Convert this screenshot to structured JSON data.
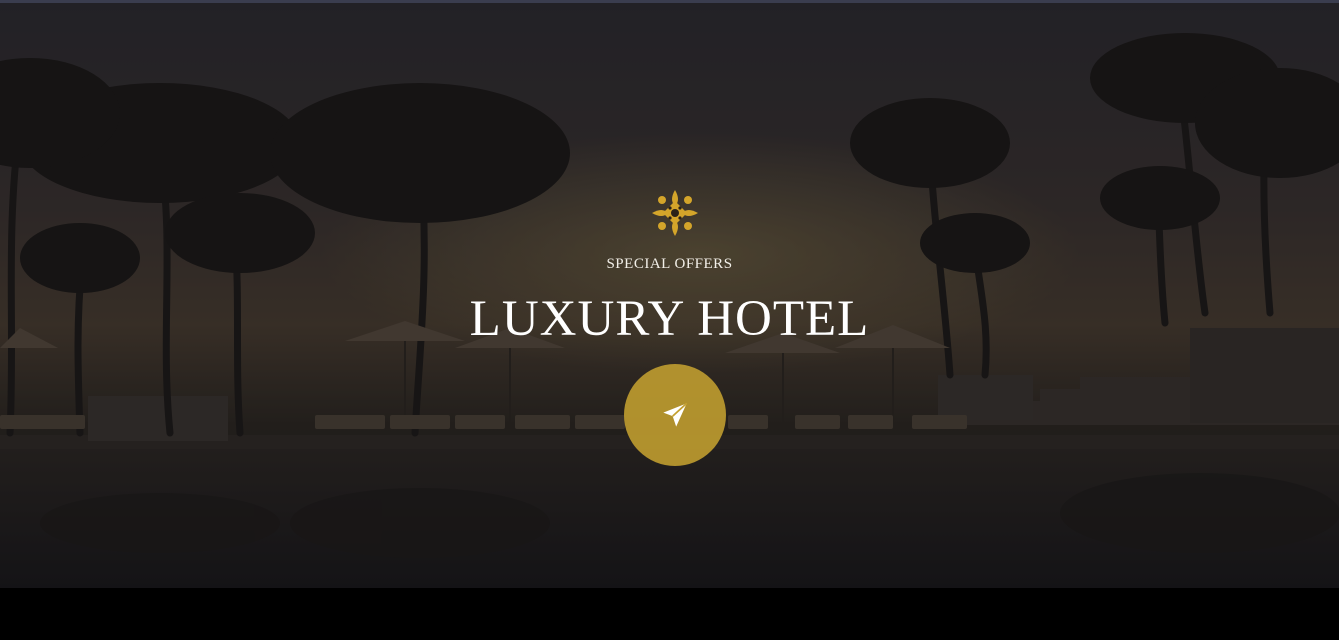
{
  "hero": {
    "eyebrow": "SPECIAL OFFERS",
    "title": "LUXURY HOTEL",
    "ornament_icon": "golden-flourish-icon",
    "action_icon": "paper-plane-icon",
    "accent_color": "#c4a030"
  }
}
